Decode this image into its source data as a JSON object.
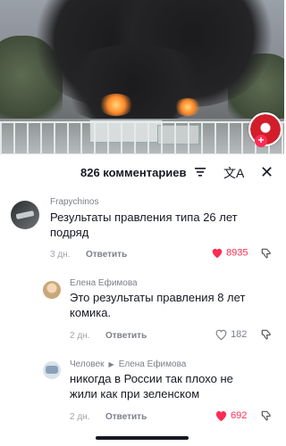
{
  "header": {
    "count_label": "826 комментариев",
    "translate_icon": "translate-icon",
    "filter_icon": "filter-icon",
    "close_icon": "close-icon"
  },
  "comments": [
    {
      "user": "Frapychinos",
      "text_line1": "Результаты правления типа 26 лет",
      "text_line2": "подряд",
      "time": "3 дн.",
      "reply_label": "Ответить",
      "likes": "8935",
      "liked": true
    },
    {
      "user": "Елена Ефимова",
      "text_line1": "Это результаты правления 8 лет",
      "text_line2": "комика.",
      "time": "2 дн.",
      "reply_label": "Ответить",
      "likes": "182",
      "liked": false
    },
    {
      "user_from": "Человек",
      "user_to": "Елена Ефимова",
      "text_line1": "никогда в России так плохо не",
      "text_line2": "жили как при зеленском",
      "time": "2 дн.",
      "reply_label": "Ответить",
      "likes": "692",
      "liked": true
    }
  ],
  "colors": {
    "like_red": "#fe2c55",
    "text": "#161823",
    "muted": "#a0a3aa"
  }
}
